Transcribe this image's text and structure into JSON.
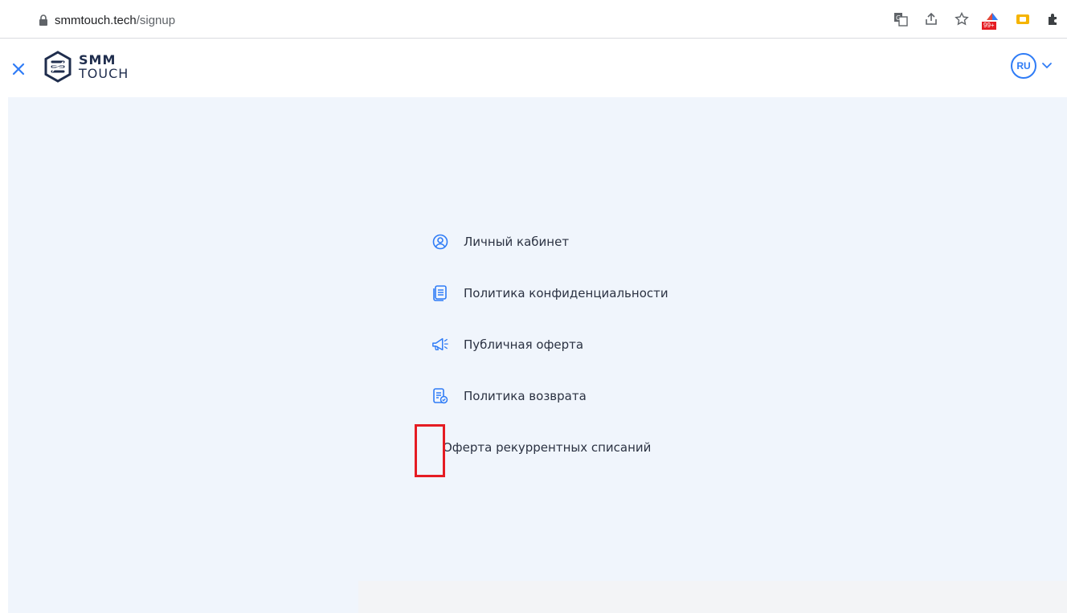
{
  "browser": {
    "url_host": "smmtouch.tech",
    "url_path": "/signup",
    "extension_badge": "99+"
  },
  "header": {
    "logo_line1": "SMM",
    "logo_line2": "TOUCH",
    "language": "RU"
  },
  "menu": {
    "items": [
      {
        "label": "Личный кабинет",
        "icon": "user-circle-icon"
      },
      {
        "label": "Политика конфиденциальности",
        "icon": "document-icon"
      },
      {
        "label": "Публичная оферта",
        "icon": "megaphone-icon"
      },
      {
        "label": "Политика возврата",
        "icon": "refund-document-icon"
      },
      {
        "label": "Оферта рекуррентных списаний",
        "icon": ""
      }
    ]
  },
  "colors": {
    "accent": "#2f7cf6",
    "background": "#f0f5fc",
    "text": "#2b3242",
    "highlight": "#e51c23"
  }
}
